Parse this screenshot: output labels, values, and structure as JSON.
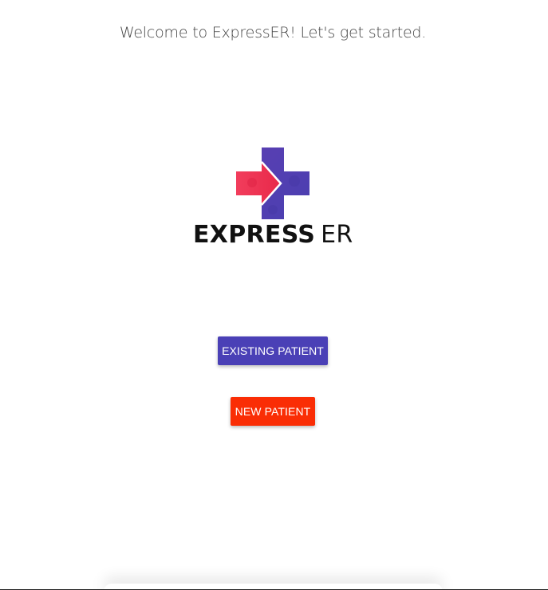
{
  "header": {
    "welcome_text": "Welcome to ExpressER! Let's get started."
  },
  "logo": {
    "icon": "medical-cross-arrow-icon",
    "text_bold": "EXPRESS",
    "text_light": "ER",
    "colors": {
      "red": "#f0344f",
      "purple": "#5140b0",
      "text": "#111111"
    }
  },
  "actions": {
    "existing_patient_label": "EXISTING PATIENT",
    "new_patient_label": "NEW PATIENT"
  },
  "colors": {
    "existing_button": "#4a40b6",
    "new_button": "#fa2d05"
  }
}
